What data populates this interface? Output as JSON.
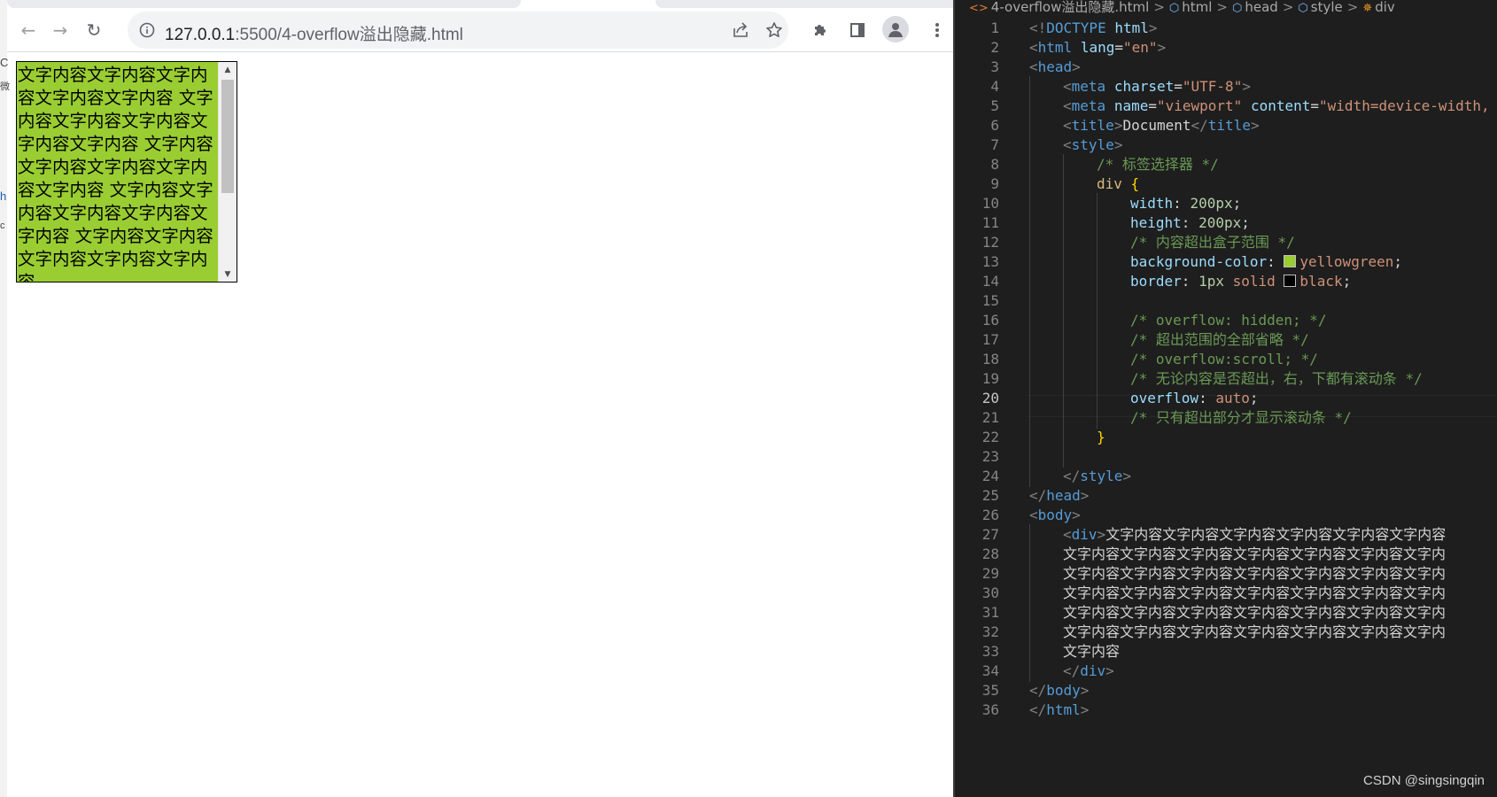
{
  "browser": {
    "url_host": "127.0.0.1",
    "url_path": ":5500/4-overflow溢出隐藏.html",
    "side_glyphs": [
      "C",
      "微",
      "h",
      "c"
    ],
    "demo_text": "文字内容文字内容文字内容文字内容文字内容 文字内容文字内容文字内容文字内容文字内容 文字内容文字内容文字内容文字内容文字内容 文字内容文字内容文字内容文字内容文字内容 文字内容文字内容文字内容文字内容文字内容",
    "box_color": "#9acd32"
  },
  "editor": {
    "breadcrumb": [
      "4-overflow溢出隐藏.html",
      "html",
      "head",
      "style",
      "div"
    ],
    "current_line": 20,
    "watermark": "CSDN @singsingqin"
  }
}
